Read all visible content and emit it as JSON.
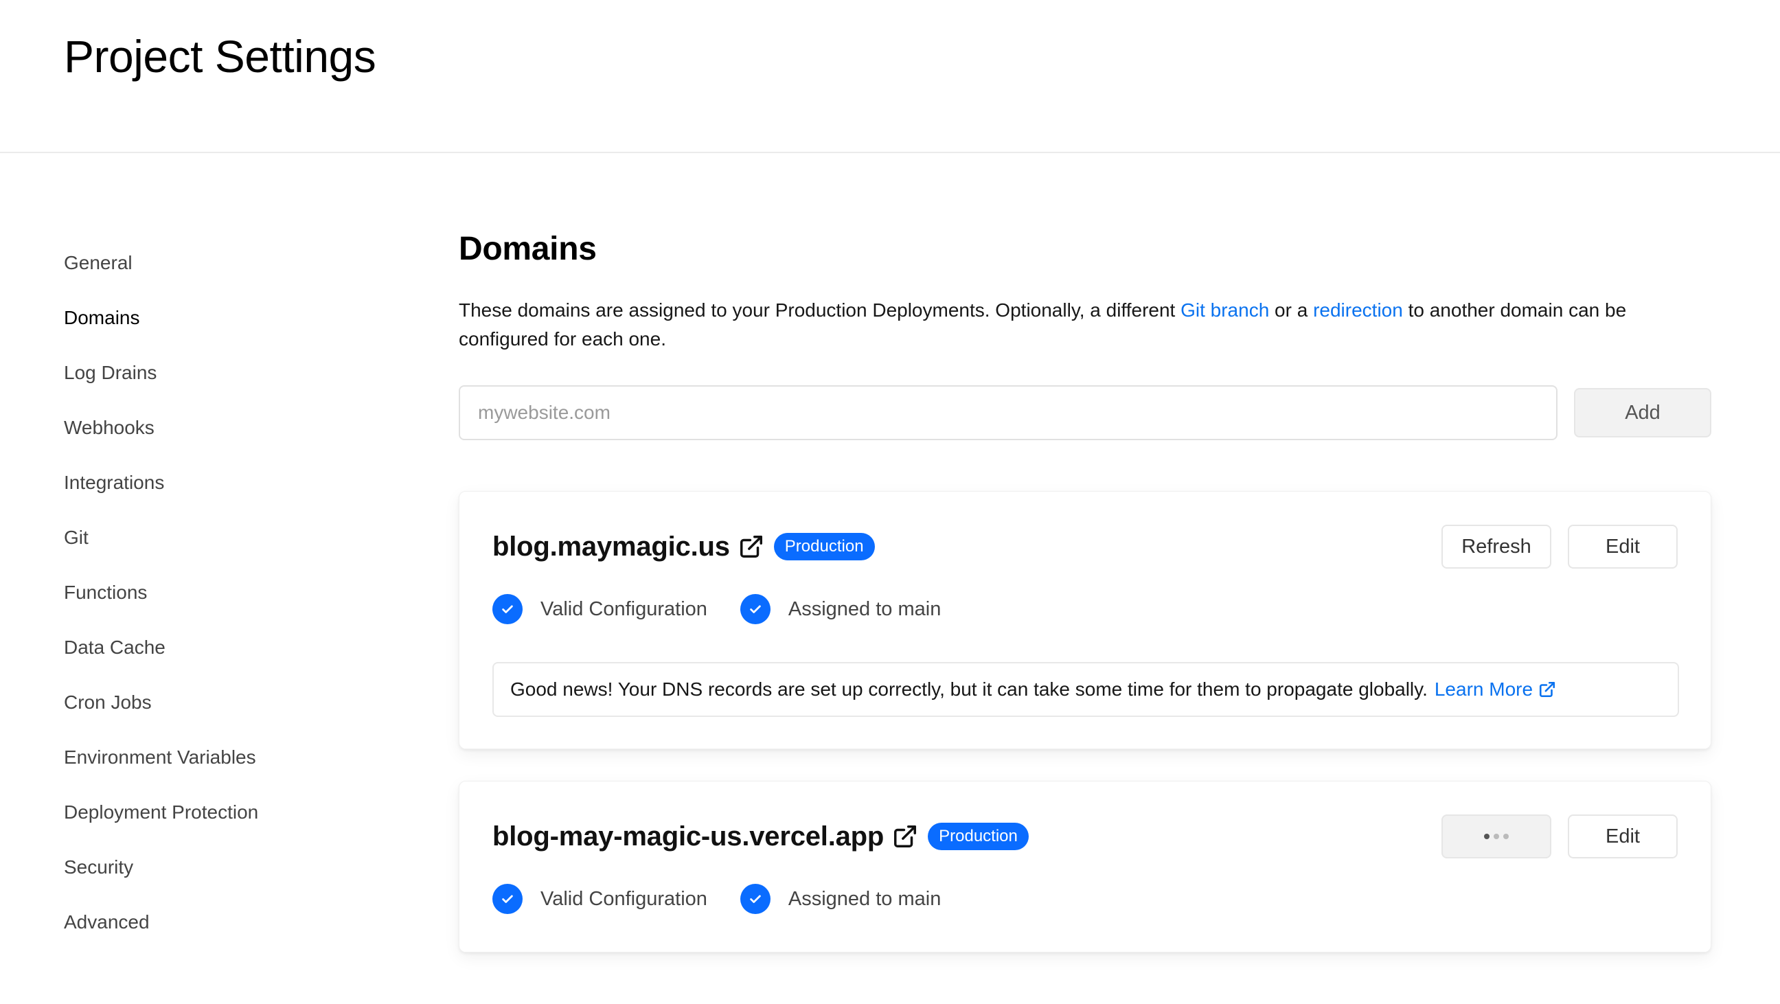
{
  "header": {
    "title": "Project Settings"
  },
  "sidebar": {
    "items": [
      {
        "label": "General",
        "active": false
      },
      {
        "label": "Domains",
        "active": true
      },
      {
        "label": "Log Drains",
        "active": false
      },
      {
        "label": "Webhooks",
        "active": false
      },
      {
        "label": "Integrations",
        "active": false
      },
      {
        "label": "Git",
        "active": false
      },
      {
        "label": "Functions",
        "active": false
      },
      {
        "label": "Data Cache",
        "active": false
      },
      {
        "label": "Cron Jobs",
        "active": false
      },
      {
        "label": "Environment Variables",
        "active": false
      },
      {
        "label": "Deployment Protection",
        "active": false
      },
      {
        "label": "Security",
        "active": false
      },
      {
        "label": "Advanced",
        "active": false
      }
    ]
  },
  "main": {
    "title": "Domains",
    "description": {
      "part1": "These domains are assigned to your Production Deployments. Optionally, a different ",
      "link1": "Git branch",
      "part2": " or a ",
      "link2": "redirection",
      "part3": " to another domain can be configured for each one."
    },
    "add_domain": {
      "placeholder": "mywebsite.com",
      "value": "",
      "button_label": "Add"
    },
    "domains": [
      {
        "name": "blog.maymagic.us",
        "badge": "Production",
        "actions": {
          "refresh": "Refresh",
          "edit": "Edit"
        },
        "statuses": [
          "Valid Configuration",
          "Assigned to main"
        ],
        "notice": {
          "text": "Good news! Your DNS records are set up correctly, but it can take some time for them to propagate globally.",
          "link": "Learn More"
        }
      },
      {
        "name": "blog-may-magic-us.vercel.app",
        "badge": "Production",
        "actions": {
          "edit": "Edit",
          "refresh_state": "loading"
        },
        "statuses": [
          "Valid Configuration",
          "Assigned to main"
        ]
      }
    ]
  },
  "colors": {
    "accent": "#0a6cff",
    "link": "#0a72ef",
    "border": "#e6e6e6"
  },
  "icons": {
    "external_link": "external-link-icon",
    "check": "check-circle-icon",
    "loading": "loading-dots-icon"
  }
}
